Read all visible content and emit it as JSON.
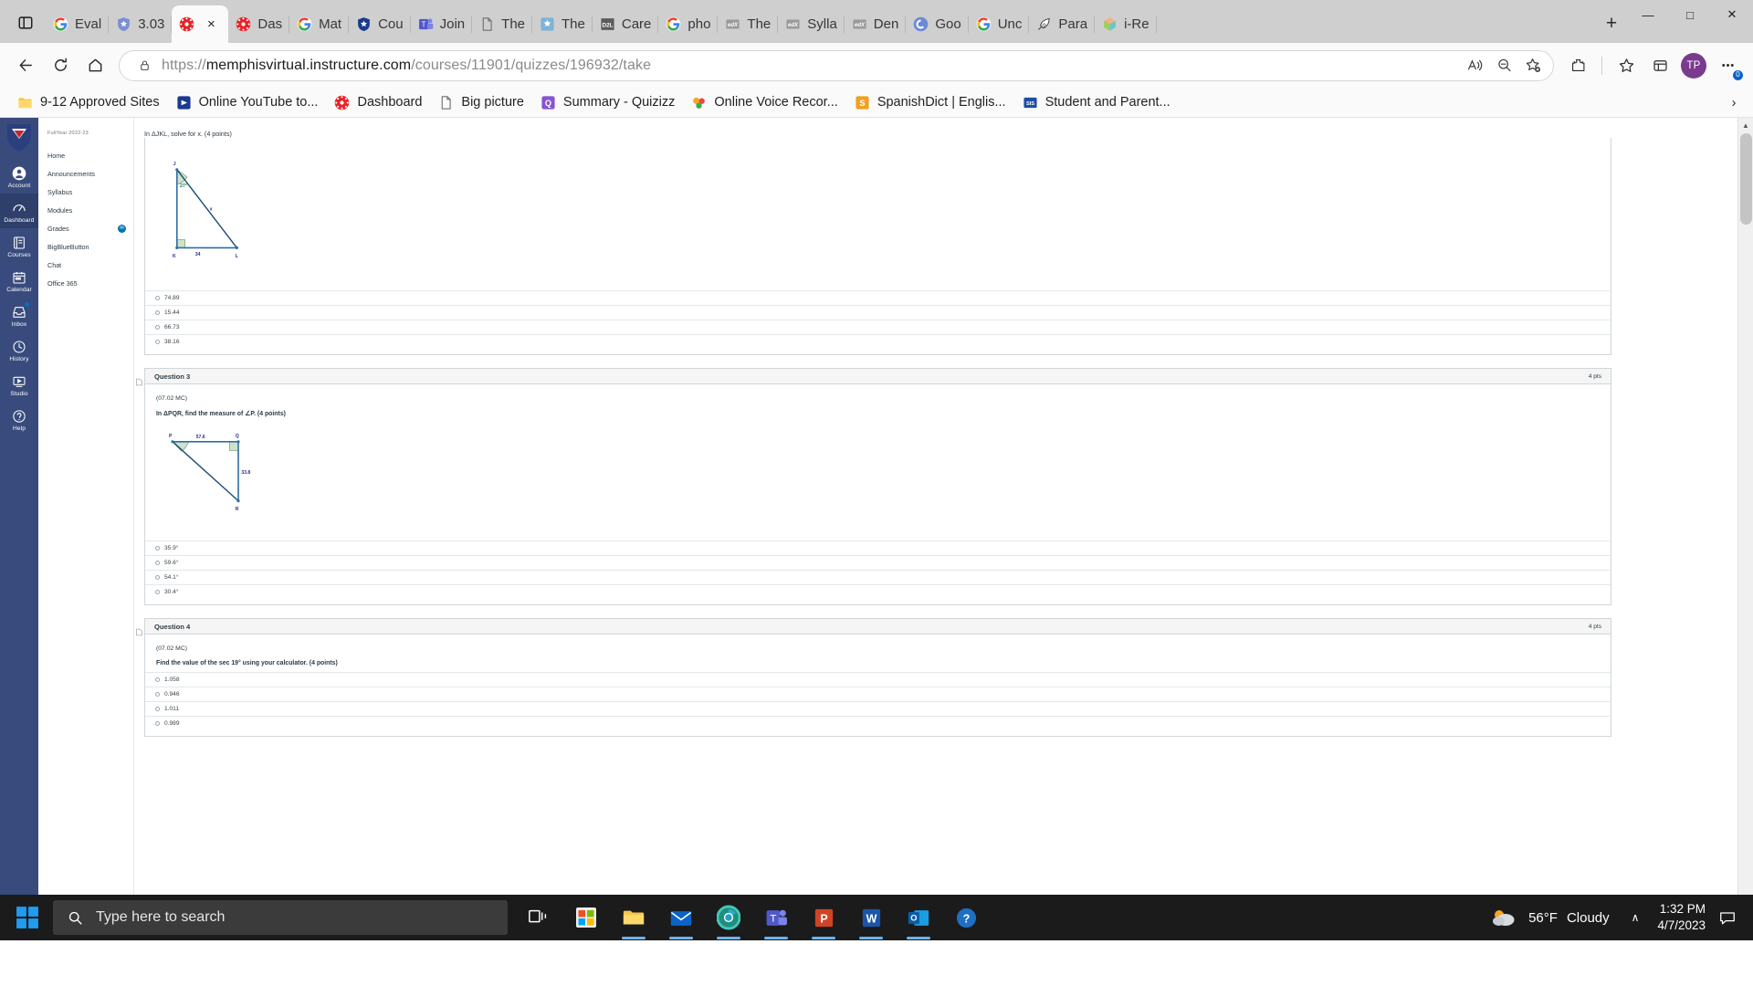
{
  "browser": {
    "tabs": [
      {
        "label": "Eval",
        "icon": "google-icon",
        "active": false
      },
      {
        "label": "3.03",
        "icon": "shield-blue-icon",
        "active": false
      },
      {
        "label": "",
        "icon": "canvas-icon",
        "active": true
      },
      {
        "label": "Das",
        "icon": "canvas-icon",
        "active": false
      },
      {
        "label": "Mat",
        "icon": "google-icon",
        "active": false
      },
      {
        "label": "Cou",
        "icon": "shield-darkblue-icon",
        "active": false
      },
      {
        "label": "Join",
        "icon": "teams-icon",
        "active": false
      },
      {
        "label": "The",
        "icon": "document-icon",
        "active": false
      },
      {
        "label": "The",
        "icon": "shield-lightblue-icon",
        "active": false
      },
      {
        "label": "Care",
        "icon": "d2l-icon",
        "active": false
      },
      {
        "label": "pho",
        "icon": "google-icon",
        "active": false
      },
      {
        "label": "The",
        "icon": "edx-icon",
        "active": false
      },
      {
        "label": "Sylla",
        "icon": "edx-icon",
        "active": false
      },
      {
        "label": "Den",
        "icon": "edx-icon",
        "active": false
      },
      {
        "label": "Goo",
        "icon": "canvas-c-icon",
        "active": false
      },
      {
        "label": "Unc",
        "icon": "google-icon",
        "active": false
      },
      {
        "label": "Para",
        "icon": "quill-icon",
        "active": false
      },
      {
        "label": "i-Re",
        "icon": "cube-icon",
        "active": false
      }
    ],
    "close_tab_label": "×",
    "new_tab_label": "+",
    "window_controls": {
      "minimize": "—",
      "maximize": "□",
      "close": "✕"
    },
    "url_scheme": "https://",
    "url_host": "memphisvirtual.instructure.com",
    "url_path": "/courses/11901/quizzes/196932/take",
    "profile_initials": "TP",
    "settings_badge": "0",
    "bookmarks": [
      {
        "label": "9-12 Approved Sites",
        "icon": "folder-icon"
      },
      {
        "label": "Online YouTube to...",
        "icon": "blue-app-icon"
      },
      {
        "label": "Dashboard",
        "icon": "canvas-icon"
      },
      {
        "label": "Big picture",
        "icon": "document-icon"
      },
      {
        "label": "Summary - Quizizz",
        "icon": "quizizz-icon"
      },
      {
        "label": "Online Voice Recor...",
        "icon": "voice-recorder-icon"
      },
      {
        "label": "SpanishDict | Englis...",
        "icon": "spanishdict-icon"
      },
      {
        "label": "Student and Parent...",
        "icon": "sis-icon"
      }
    ],
    "bookmarks_overflow": "›"
  },
  "canvas": {
    "global_nav": [
      {
        "label": "Account",
        "icon": "account-icon",
        "selected": false,
        "badge": false
      },
      {
        "label": "Dashboard",
        "icon": "dashboard-icon",
        "selected": true,
        "badge": false
      },
      {
        "label": "Courses",
        "icon": "courses-icon",
        "selected": false,
        "badge": false
      },
      {
        "label": "Calendar",
        "icon": "calendar-icon",
        "selected": false,
        "badge": false
      },
      {
        "label": "Inbox",
        "icon": "inbox-icon",
        "selected": false,
        "badge": true
      },
      {
        "label": "History",
        "icon": "history-icon",
        "selected": false,
        "badge": false
      },
      {
        "label": "Studio",
        "icon": "studio-icon",
        "selected": false,
        "badge": false
      },
      {
        "label": "Help",
        "icon": "help-icon",
        "selected": false,
        "badge": false
      }
    ],
    "collapse_label": "←|",
    "course_term": "FullYear 2022-23",
    "course_nav": [
      {
        "label": "Home",
        "badge": null
      },
      {
        "label": "Announcements",
        "badge": null
      },
      {
        "label": "Syllabus",
        "badge": null
      },
      {
        "label": "Modules",
        "badge": null
      },
      {
        "label": "Grades",
        "badge": "✉"
      },
      {
        "label": "BigBlueButton",
        "badge": null
      },
      {
        "label": "Chat",
        "badge": null
      },
      {
        "label": "Office 365",
        "badge": null
      }
    ]
  },
  "quiz": {
    "partial_question_text": "In ΔJKL, solve for x. (4 points)",
    "questions": [
      {
        "id": "q2-partial",
        "title": null,
        "points": null,
        "code": null,
        "prompt": null,
        "figure": {
          "type": "right-triangle",
          "vertices": [
            "J",
            "K",
            "L"
          ],
          "angle_label": "27°",
          "side_labels": {
            "hypotenuse": "x",
            "base": "34"
          }
        },
        "answers": [
          "74.89",
          "15.44",
          "66.73",
          "38.16"
        ]
      },
      {
        "id": "q3",
        "title": "Question 3",
        "points": "4 pts",
        "code": "(07.02 MC)",
        "prompt": "In ΔPQR, find the measure of ∠P. (4 points)",
        "figure": {
          "type": "right-triangle",
          "vertices": [
            "P",
            "Q",
            "R"
          ],
          "side_labels": {
            "top": "57.6",
            "right": "33.8"
          }
        },
        "answers": [
          "35.9°",
          "59.6°",
          "54.1°",
          "30.4°"
        ]
      },
      {
        "id": "q4",
        "title": "Question 4",
        "points": "4 pts",
        "code": "(07.02 MC)",
        "prompt": "Find the value of the sec 19° using your calculator. (4 points)",
        "figure": null,
        "answers": [
          "1.058",
          "0.946",
          "1.011",
          "0.989"
        ]
      }
    ]
  },
  "taskbar": {
    "search_placeholder": "Type here to search",
    "apps": [
      {
        "name": "task-view-icon"
      },
      {
        "name": "microsoft-store-icon"
      },
      {
        "name": "file-explorer-icon"
      },
      {
        "name": "mail-icon"
      },
      {
        "name": "chrome-icon"
      },
      {
        "name": "teams-icon"
      },
      {
        "name": "powerpoint-icon"
      },
      {
        "name": "word-icon"
      },
      {
        "name": "outlook-icon"
      },
      {
        "name": "help-icon"
      }
    ],
    "weather_temp": "56°F",
    "weather_cond": "Cloudy",
    "time": "1:32 PM",
    "date": "4/7/2023",
    "tray_chevron": "∧"
  }
}
